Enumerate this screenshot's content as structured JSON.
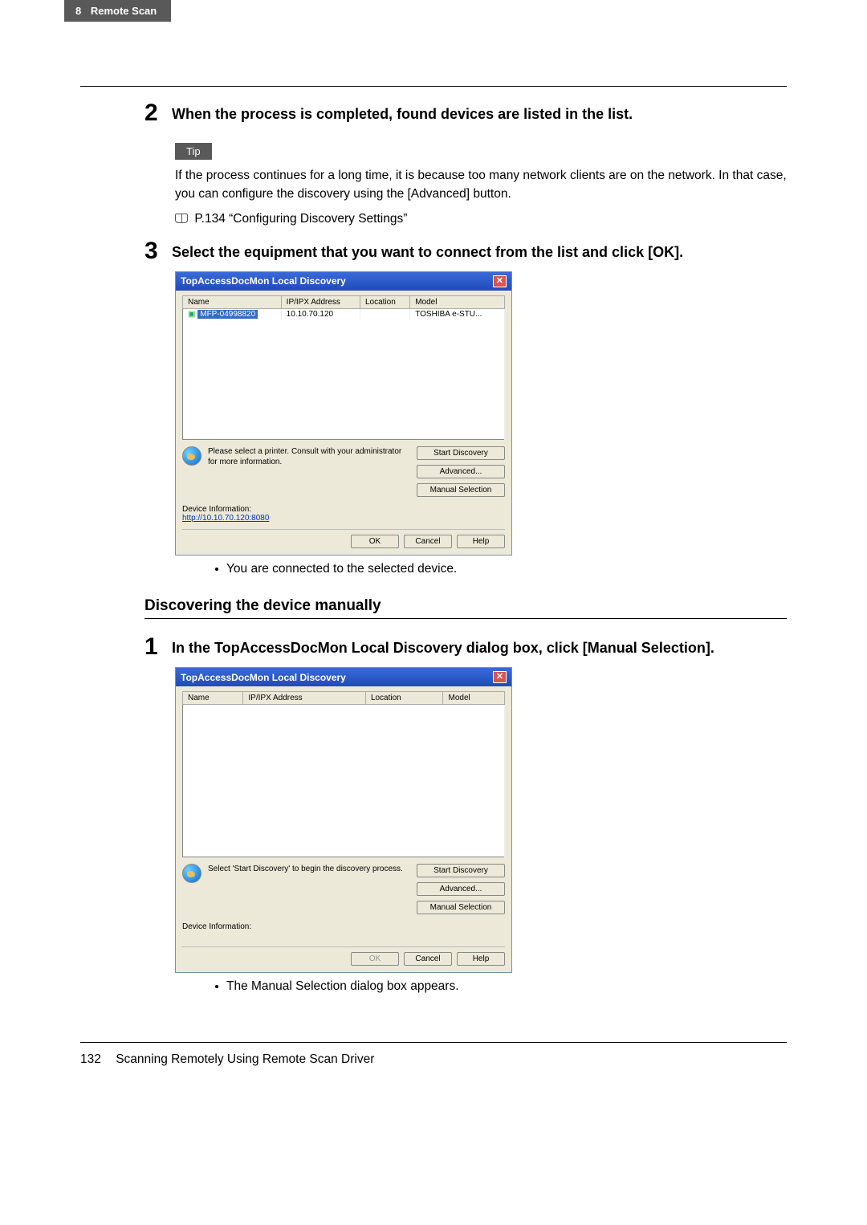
{
  "header": {
    "chapter_num": "8",
    "chapter_title": "Remote Scan"
  },
  "step2": {
    "num": "2",
    "title": "When the process is completed, found devices are listed in the list.",
    "tip_label": "Tip",
    "tip_text": "If the process continues for a long time, it is because too many network clients are on the network.  In that case, you can configure the discovery using the [Advanced] button.",
    "ref": "P.134 “Configuring Discovery Settings”"
  },
  "step3": {
    "num": "3",
    "title": "Select the equipment that you want to connect from the list and click [OK].",
    "note": "You are connected to the selected device."
  },
  "dialog1": {
    "title": "TopAccessDocMon Local Discovery",
    "cols": {
      "name": "Name",
      "ip": "IP/IPX Address",
      "loc": "Location",
      "model": "Model"
    },
    "row": {
      "name": "MFP-04998820",
      "ip": "10.10.70.120",
      "loc": "",
      "model": "TOSHIBA e-STU..."
    },
    "msg": "Please select a printer. Consult with your administrator for more information.",
    "btn_start": "Start Discovery",
    "btn_adv": "Advanced...",
    "btn_manual": "Manual Selection",
    "devinfo_label": "Device Information:",
    "devinfo_link": "http://10.10.70.120:8080",
    "ok": "OK",
    "cancel": "Cancel",
    "help": "Help"
  },
  "subsection": {
    "title": "Discovering the device manually"
  },
  "step1b": {
    "num": "1",
    "title": "In the TopAccessDocMon Local Discovery dialog box, click [Manual Selection].",
    "note": "The Manual Selection dialog box appears."
  },
  "dialog2": {
    "title": "TopAccessDocMon Local Discovery",
    "cols": {
      "name": "Name",
      "ip": "IP/IPX Address",
      "loc": "Location",
      "model": "Model"
    },
    "msg": "Select 'Start Discovery' to begin the discovery process.",
    "btn_start": "Start Discovery",
    "btn_adv": "Advanced...",
    "btn_manual": "Manual Selection",
    "devinfo_label": "Device Information:",
    "ok": "OK",
    "cancel": "Cancel",
    "help": "Help"
  },
  "footer": {
    "page_num": "132",
    "section": "Scanning Remotely Using Remote Scan Driver"
  }
}
